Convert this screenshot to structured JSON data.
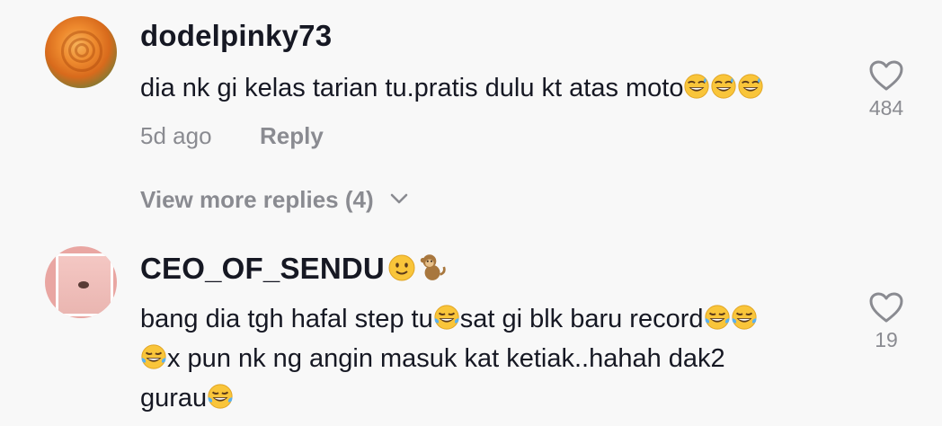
{
  "comments": [
    {
      "username": "dodelpinky73",
      "text": "dia nk gi kelas tarian tu.pratis dulu kt atas moto",
      "emojis": [
        "sweat-smile",
        "sweat-smile",
        "sweat-smile"
      ],
      "time": "5d ago",
      "reply_label": "Reply",
      "likes": "484",
      "view_more": "View more replies (4)"
    },
    {
      "username": "CEO_OF_SENDU",
      "username_emojis": [
        "slightly-smiling-face",
        "monkey"
      ],
      "lines": [
        "bang dia tgh hafal step tu",
        "sat gi blk baru record",
        "x pun nk ng angin masuk kat ketiak..hahah dak2",
        "gurau"
      ],
      "likes": "19"
    }
  ],
  "icons": {
    "like": "heart-outline-icon",
    "expand": "chevron-down-icon"
  },
  "colors": {
    "background": "#f8f8f8",
    "text": "#161823",
    "secondary": "#8a8b91",
    "emoji_yellow": "#f9c53a"
  }
}
